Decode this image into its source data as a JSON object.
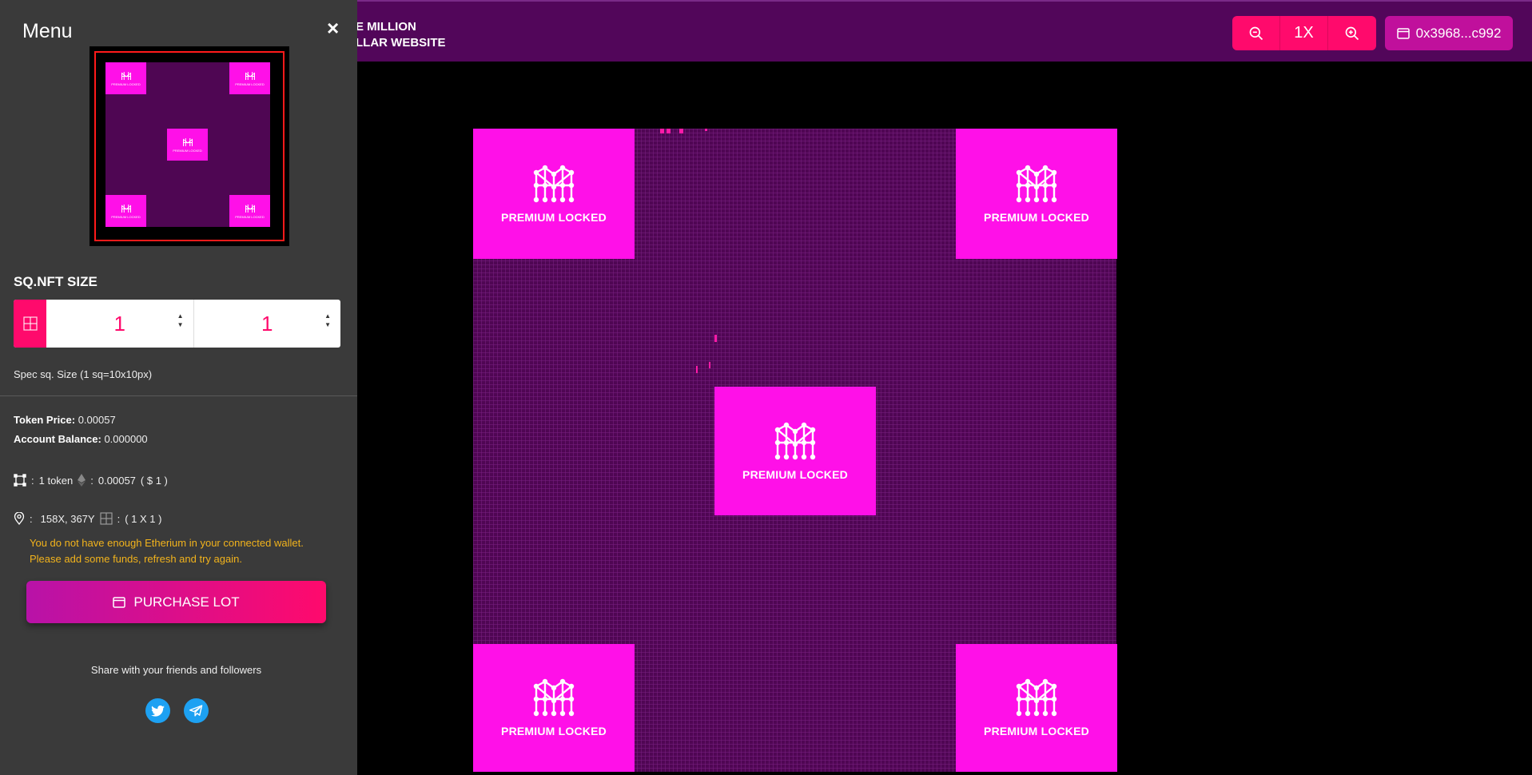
{
  "header": {
    "brand_line1": "E MILLION",
    "brand_line2": "LLAR WEBSITE",
    "zoom_level": "1X",
    "wallet_address": "0x3968...c992"
  },
  "canvas": {
    "premium_label": "PREMIUM LOCKED"
  },
  "sidebar": {
    "title": "Menu",
    "close_glyph": "×",
    "minimap_label": "PREMIUM LOCKED",
    "size_title": "SQ.NFT SIZE",
    "size_width": "1",
    "size_height": "1",
    "spec_note": "Spec sq. Size (1 sq=10x10px)",
    "token_price_label": "Token Price:",
    "token_price_value": "0.00057",
    "balance_label": "Account Balance:",
    "balance_value": "0.000000",
    "token_count": "1 token",
    "eth_cost": "0.00057",
    "usd_cost": "( $ 1 )",
    "coords": "158X, 367Y",
    "dims": "( 1 X 1 )",
    "warning_line1": "You do not have enough Etherium in your connected wallet.",
    "warning_line2": "Please add some funds, refresh and try again.",
    "purchase_label": "PURCHASE LOT",
    "share_text": "Share with your friends and followers"
  },
  "colors": {
    "accent": "#ff0a6c",
    "premium": "#ff10e8",
    "header_bg": "#52065a",
    "grid_bg": "#4f0653",
    "sidebar_bg": "#3a3a3a",
    "warning": "#f2b31c"
  },
  "icons": [
    "zoom-out-icon",
    "zoom-in-icon",
    "wallet-icon",
    "close-icon",
    "grid-icon",
    "square-select-icon",
    "ethereum-icon",
    "location-pin-icon",
    "twitter-icon",
    "telegram-icon",
    "premium-logo-icon"
  ]
}
